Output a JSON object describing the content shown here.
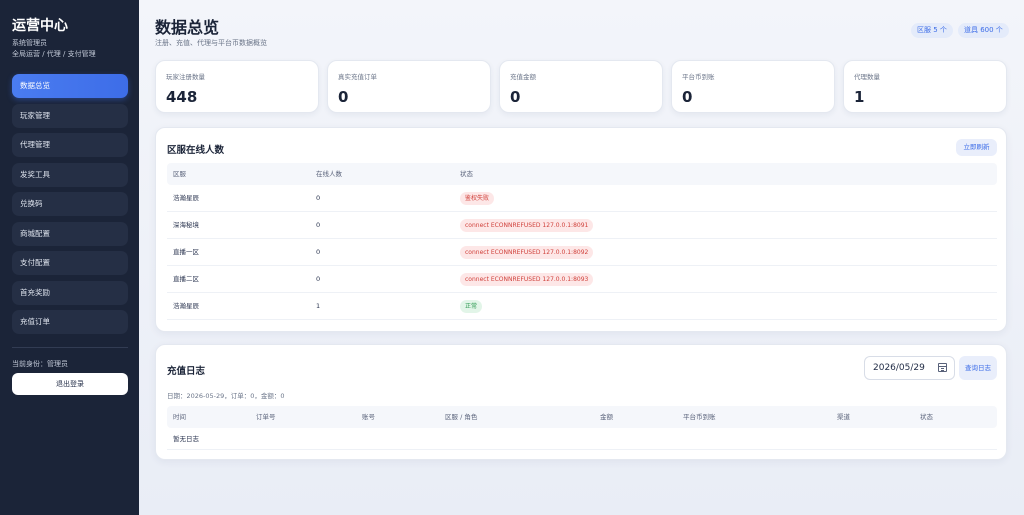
{
  "sidebar": {
    "brand": "运营中心",
    "role_line1": "系统管理员",
    "role_line2": "全局运营 / 代理 / 支付管理",
    "items": [
      {
        "label": "数据总览",
        "active": true
      },
      {
        "label": "玩家管理"
      },
      {
        "label": "代理管理"
      },
      {
        "label": "发奖工具"
      },
      {
        "label": "兑换码"
      },
      {
        "label": "商城配置"
      },
      {
        "label": "支付配置"
      },
      {
        "label": "首充奖励"
      },
      {
        "label": "充值订单"
      }
    ],
    "identity": "当前身份：管理员",
    "logout_label": "退出登录"
  },
  "header": {
    "title": "数据总览",
    "subtitle": "注册、充值、代理与平台币数据概览",
    "pill_servers": "区服 5 个",
    "pill_items": "道具 600 个"
  },
  "stats": [
    {
      "label": "玩家注册数量",
      "value": "448"
    },
    {
      "label": "真实充值订单",
      "value": "0"
    },
    {
      "label": "充值金额",
      "value": "0"
    },
    {
      "label": "平台币到账",
      "value": "0"
    },
    {
      "label": "代理数量",
      "value": "1"
    }
  ],
  "online": {
    "title": "区服在线人数",
    "refresh_label": "立即刷新",
    "columns": [
      "区服",
      "在线人数",
      "状态"
    ],
    "rows": [
      {
        "server": "浩瀚星辰",
        "count": "0",
        "status": "鉴权失败",
        "state": "err"
      },
      {
        "server": "深海秘境",
        "count": "0",
        "status": "connect ECONNREFUSED 127.0.0.1:8091",
        "state": "err"
      },
      {
        "server": "直播一区",
        "count": "0",
        "status": "connect ECONNREFUSED 127.0.0.1:8092",
        "state": "err"
      },
      {
        "server": "直播二区",
        "count": "0",
        "status": "connect ECONNREFUSED 127.0.0.1:8093",
        "state": "err"
      },
      {
        "server": "浩瀚星辰",
        "count": "1",
        "status": "正常",
        "state": "ok"
      }
    ]
  },
  "log": {
    "title": "充值日志",
    "date_value": "2026/05/29",
    "query_label": "查询日志",
    "meta": "日期：2026-05-29，订单：0，金额：0",
    "columns": [
      "时间",
      "订单号",
      "账号",
      "区服 / 角色",
      "金额",
      "平台币到账",
      "渠道",
      "状态"
    ],
    "empty_text": "暂无日志"
  },
  "colors": {
    "sidebar_bg": "#1b2438",
    "accent": "#3d6de8",
    "error": "#d0413b",
    "success": "#2f9a52"
  }
}
